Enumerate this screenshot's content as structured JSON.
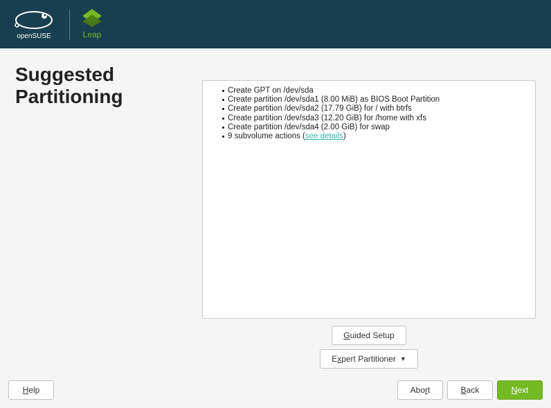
{
  "header": {
    "brand": "openSUSE",
    "product": "Leap"
  },
  "page": {
    "title_line1": "Suggested",
    "title_line2": "Partitioning"
  },
  "actions": [
    {
      "text": "Create GPT on /dev/sda"
    },
    {
      "text": "Create partition /dev/sda1 (8.00 MiB) as BIOS Boot Partition"
    },
    {
      "text": "Create partition /dev/sda2 (17.79 GiB) for / with btrfs"
    },
    {
      "text": "Create partition /dev/sda3 (12.20 GiB) for /home with xfs"
    },
    {
      "text": "Create partition /dev/sda4 (2.00 GiB) for swap"
    }
  ],
  "subvol": {
    "prefix": "9 subvolume actions (",
    "link": "see details",
    "suffix": ")"
  },
  "buttons": {
    "guided_u": "G",
    "guided_rest": "uided Setup",
    "expert_pre": "E",
    "expert_u": "x",
    "expert_rest": "pert Partitioner",
    "help_u": "H",
    "help_rest": "elp",
    "abort_pre": "Abo",
    "abort_u": "r",
    "abort_rest": "t",
    "back_u": "B",
    "back_rest": "ack",
    "next_u": "N",
    "next_rest": "ext"
  }
}
